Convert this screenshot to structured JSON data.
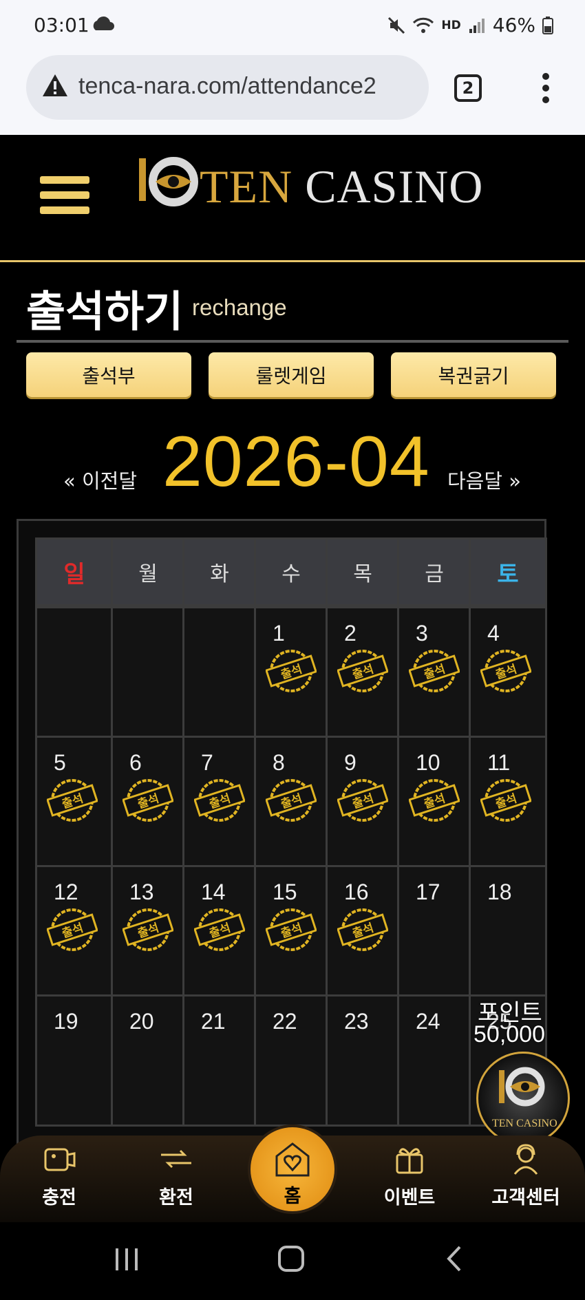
{
  "status_bar": {
    "time": "03:01",
    "battery": "46%",
    "hd_label": "HD"
  },
  "browser": {
    "url": "tenca-nara.com/attendance2",
    "tab_count": "2"
  },
  "header": {
    "logo_ten": "TEN",
    "logo_casino": "CASINO"
  },
  "page": {
    "title": "출석하기",
    "subtitle": "rechange",
    "tabs": [
      "출석부",
      "룰렛게임",
      "복권긁기"
    ]
  },
  "month_nav": {
    "prev": "« 이전달",
    "current": "2026-04",
    "next": "다음달 »"
  },
  "calendar": {
    "weekdays": [
      "일",
      "월",
      "화",
      "수",
      "목",
      "금",
      "토"
    ],
    "first_weekday_index": 3,
    "days_visible": 25,
    "attended_days": [
      1,
      2,
      3,
      4,
      5,
      6,
      7,
      8,
      9,
      10,
      11,
      12,
      13,
      14,
      15,
      16
    ],
    "stamp_text": "출석"
  },
  "points": {
    "label": "포인트",
    "value": "50,000",
    "badge_text": "TEN CASINO"
  },
  "bottom_nav": {
    "items": [
      "충전",
      "환전",
      "홈",
      "이벤트",
      "고객센터"
    ]
  }
}
